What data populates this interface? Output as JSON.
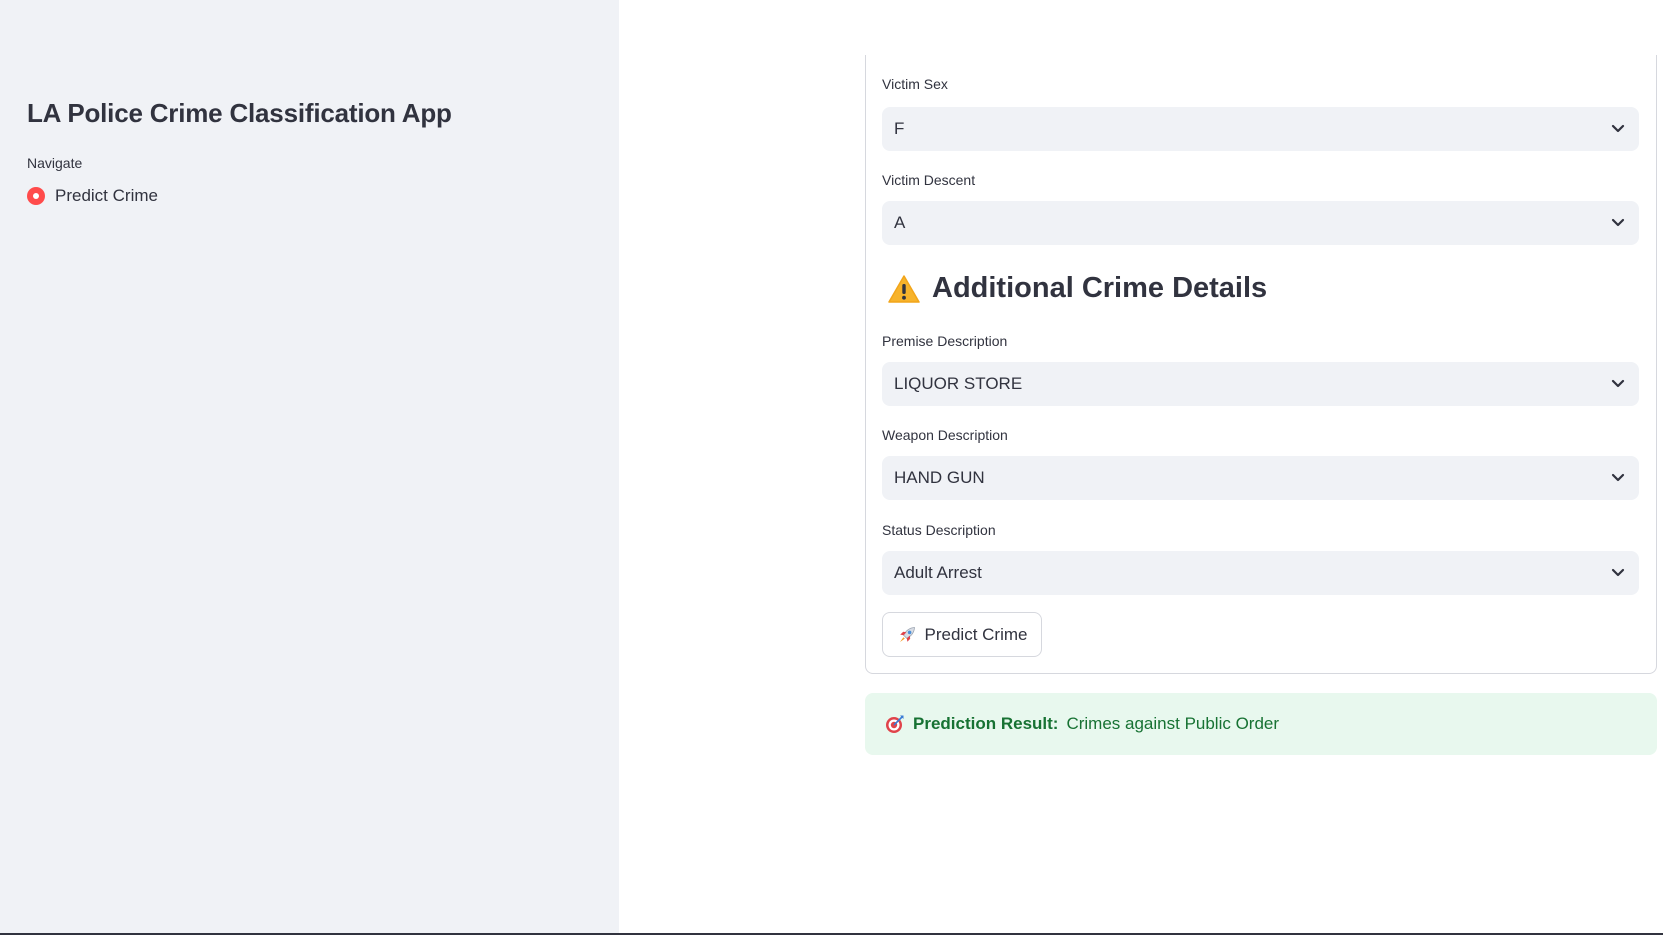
{
  "sidebar": {
    "title": "LA Police Crime Classification App",
    "nav_label": "Navigate",
    "nav_options": [
      "Predict Crime"
    ],
    "selected": "Predict Crime"
  },
  "form": {
    "victim_sex": {
      "label": "Victim Sex",
      "value": "F"
    },
    "victim_descent": {
      "label": "Victim Descent",
      "value": "A"
    },
    "section_title": "Additional Crime Details",
    "premise": {
      "label": "Premise Description",
      "value": "LIQUOR STORE"
    },
    "weapon": {
      "label": "Weapon Description",
      "value": "HAND GUN"
    },
    "status": {
      "label": "Status Description",
      "value": "Adult Arrest"
    },
    "submit_label": "Predict Crime"
  },
  "result": {
    "lead": "Prediction Result:",
    "value": "Crimes against Public Order"
  },
  "icons": {
    "section": "warning-icon",
    "submit": "rocket-icon",
    "result": "target-icon"
  },
  "colors": {
    "accent": "#ff4b4b",
    "success_bg": "#e8f8ee",
    "success_text": "#177233"
  }
}
